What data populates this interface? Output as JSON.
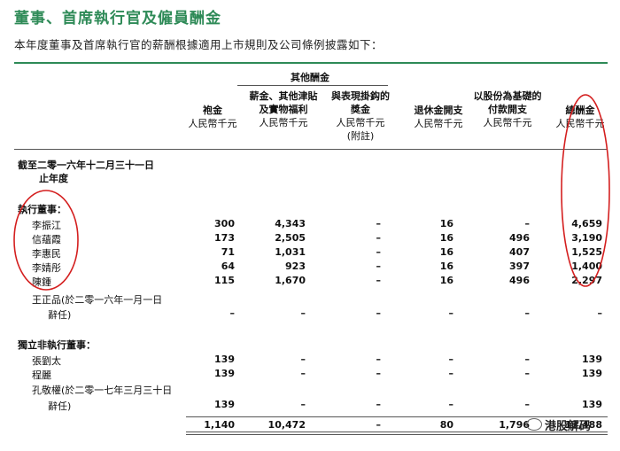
{
  "title": "董事、首席執行官及僱員酬金",
  "intro": "本年度董事及首席執行官的薪酬根據適用上市規則及公司條例披露如下：",
  "headers": {
    "group": "其他酬金",
    "col1": [
      "袍金",
      "人民幣千元"
    ],
    "col2": [
      "薪金、其他津貼",
      "及實物福利",
      "人民幣千元"
    ],
    "col3": [
      "與表現掛鈎的",
      "獎金",
      "人民幣千元",
      "(附註)"
    ],
    "col4": [
      "退休金開支",
      "人民幣千元"
    ],
    "col5": [
      "以股份為基礎的",
      "付款開支",
      "人民幣千元"
    ],
    "col6": [
      "總酬金",
      "人民幣千元"
    ]
  },
  "period": [
    "截至二零一六年十二月三十一日",
    "止年度"
  ],
  "sections": {
    "executive": "執行董事：",
    "independent": "獨立非執行董事："
  },
  "exec_rows": [
    {
      "name": "李振江",
      "values": [
        "300",
        "4,343",
        "–",
        "16",
        "–",
        "4,659"
      ]
    },
    {
      "name": "信蘊霞",
      "values": [
        "173",
        "2,505",
        "–",
        "16",
        "496",
        "3,190"
      ]
    },
    {
      "name": "李惠民",
      "values": [
        "71",
        "1,031",
        "–",
        "16",
        "407",
        "1,525"
      ]
    },
    {
      "name": "李婧彤",
      "values": [
        "64",
        "923",
        "–",
        "16",
        "397",
        "1,400"
      ]
    },
    {
      "name": "陳鍾",
      "values": [
        "115",
        "1,670",
        "–",
        "16",
        "496",
        "2,297"
      ]
    }
  ],
  "wang_row": {
    "name": [
      "王正品(於二零一六年一月一日",
      "辭任)"
    ],
    "values": [
      "–",
      "–",
      "–",
      "–",
      "–",
      "–"
    ]
  },
  "indep_rows": [
    {
      "name": "張劉太",
      "values": [
        "139",
        "–",
        "–",
        "–",
        "–",
        "139"
      ]
    },
    {
      "name": "程麗",
      "values": [
        "139",
        "–",
        "–",
        "–",
        "–",
        "139"
      ]
    }
  ],
  "kong_row": {
    "name": [
      "孔敬權(於二零一七年三月三十日",
      "辭任)"
    ],
    "values": [
      "139",
      "–",
      "–",
      "–",
      "–",
      "139"
    ]
  },
  "totals": [
    "1,140",
    "10,472",
    "–",
    "80",
    "1,796",
    "13,488"
  ],
  "watermark": "港股解码",
  "colors": {
    "title": "#2e8a57",
    "annotation": "#d41f1f"
  }
}
